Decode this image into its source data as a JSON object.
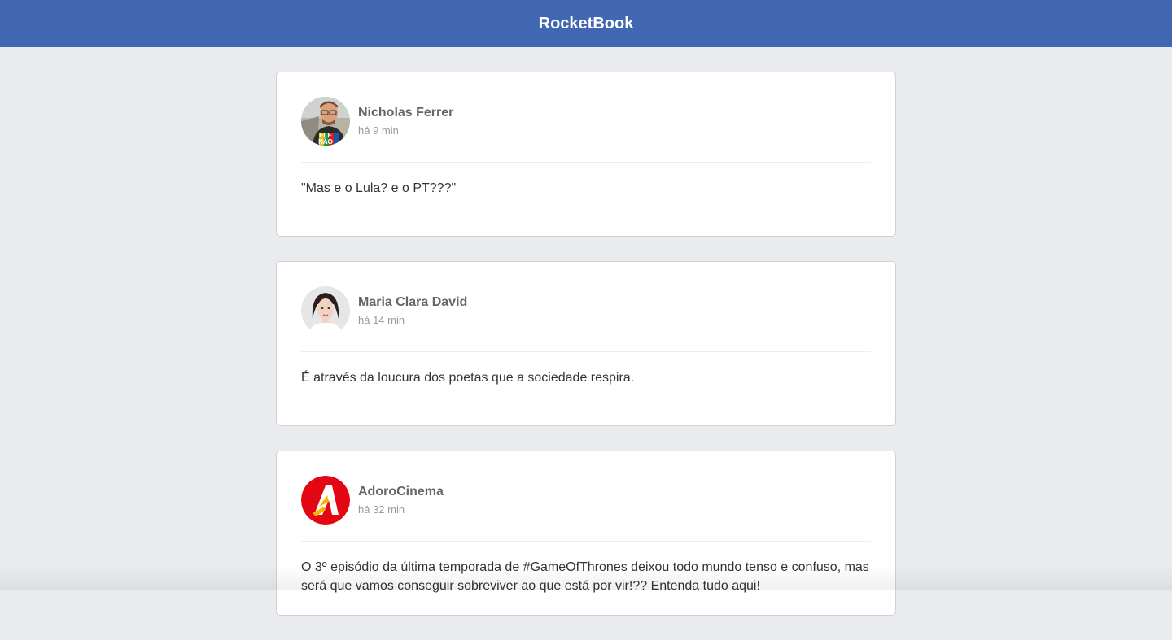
{
  "header": {
    "title": "RocketBook"
  },
  "posts": [
    {
      "author": "Nicholas Ferrer",
      "time": "há 9 min",
      "content": "\"Mas e o Lula? e o PT???\"",
      "avatar_icon": "person-photo-icon",
      "avatar_badge": [
        "ELE",
        "NÃO"
      ]
    },
    {
      "author": "Maria Clara David",
      "time": "há 14 min",
      "content": "É através da loucura dos poetas que a sociedade respira.",
      "avatar_icon": "person-photo-icon"
    },
    {
      "author": "AdoroCinema",
      "time": "há 32 min",
      "content": "O 3º episódio da última temporada de #GameOfThrones deixou todo mundo tenso e confuso, mas será que vamos conseguir sobreviver ao que está por vir!?? Entenda tudo aqui!",
      "avatar_icon": "adorocinema-logo-icon",
      "avatar_color": "#e30613"
    }
  ],
  "colors": {
    "topbar": "#4267b2",
    "background": "#e9ebee"
  }
}
